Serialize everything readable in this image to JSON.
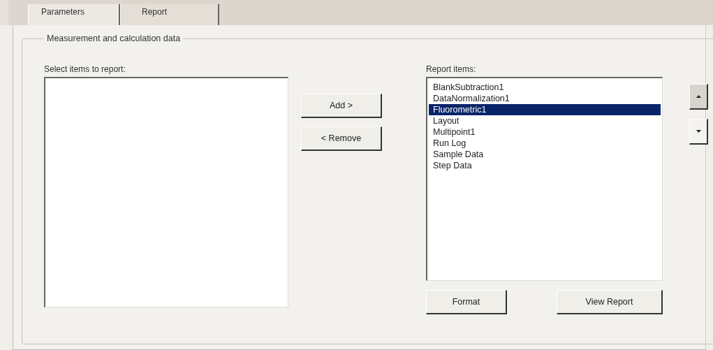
{
  "tabs": [
    {
      "label": "Parameters",
      "selected": true
    },
    {
      "label": "Report",
      "selected": false
    }
  ],
  "group": {
    "title": "Measurement and  calculation data",
    "available": {
      "label": "Select items to report:"
    },
    "transfer_buttons": [
      "Add >",
      "< Remove"
    ],
    "report": {
      "label": "Report items:",
      "items": [
        {
          "label": "BlankSubtraction1",
          "selected": false
        },
        {
          "label": "DataNormalization1",
          "selected": false
        },
        {
          "label": "Fluorometric1",
          "selected": true
        },
        {
          "label": "Layout",
          "selected": false
        },
        {
          "label": "Multipoint1",
          "selected": false
        },
        {
          "label": "Run Log",
          "selected": false
        },
        {
          "label": "Sample Data",
          "selected": false
        },
        {
          "label": "Step Data",
          "selected": false
        }
      ]
    },
    "order_buttons": [
      {
        "kind": "up"
      },
      {
        "kind": "down"
      }
    ],
    "bottom_buttons": [
      "Format",
      "View Report"
    ]
  }
}
